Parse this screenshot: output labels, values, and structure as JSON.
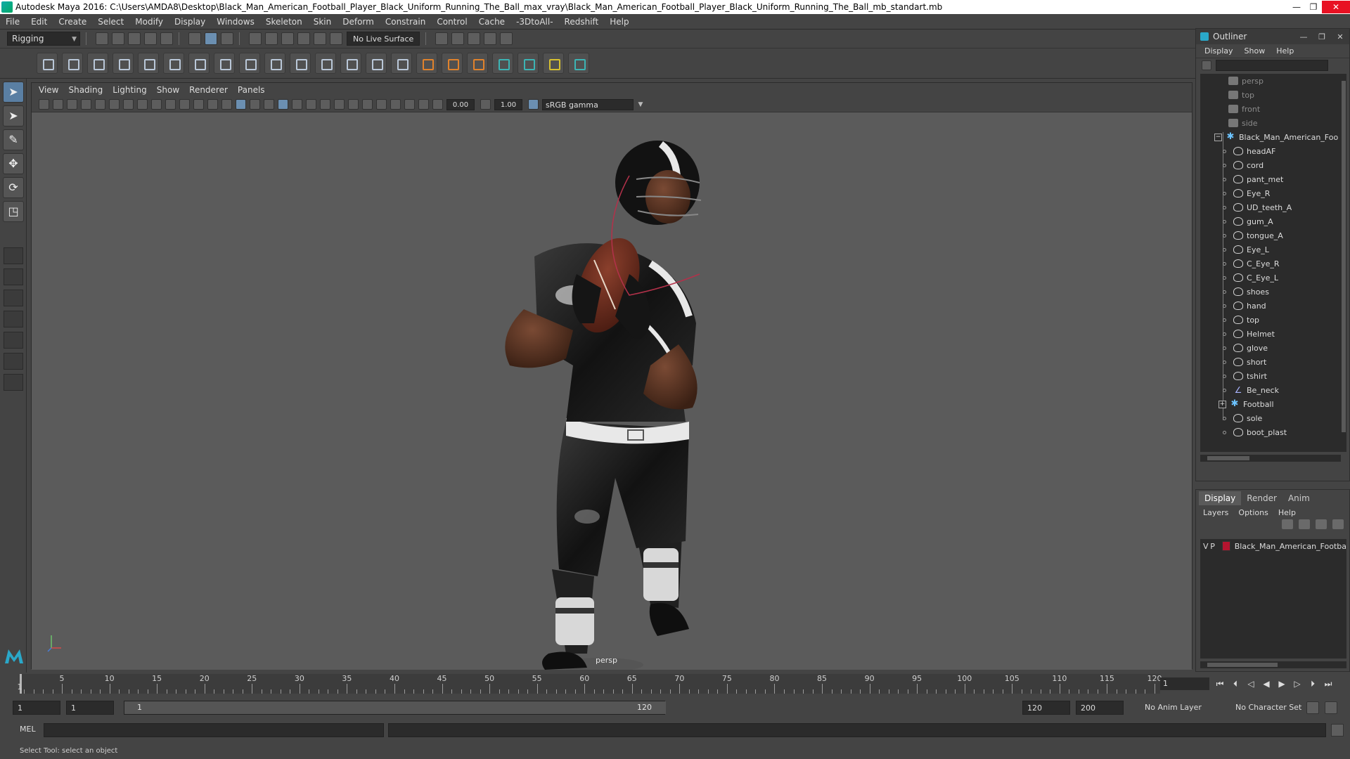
{
  "window": {
    "title": "Autodesk Maya 2016: C:\\Users\\AMDA8\\Desktop\\Black_Man_American_Football_Player_Black_Uniform_Running_The_Ball_max_vray\\Black_Man_American_Football_Player_Black_Uniform_Running_The_Ball_mb_standart.mb",
    "minimize": "—",
    "maximize": "❐",
    "close": "✕"
  },
  "menubar": [
    "File",
    "Edit",
    "Create",
    "Select",
    "Modify",
    "Display",
    "Windows",
    "Skeleton",
    "Skin",
    "Deform",
    "Constrain",
    "Control",
    "Cache",
    "-3DtoAll-",
    "Redshift",
    "Help"
  ],
  "status_line": {
    "mode": "Rigging",
    "live_surface": "No Live Surface"
  },
  "viewport": {
    "menus": [
      "View",
      "Shading",
      "Lighting",
      "Show",
      "Renderer",
      "Panels"
    ],
    "exposure": "0.00",
    "gamma": "1.00",
    "color_space": "sRGB gamma",
    "camera": "persp"
  },
  "outliner": {
    "title": "Outliner",
    "menus": [
      "Display",
      "Show",
      "Help"
    ],
    "cameras": [
      "persp",
      "top",
      "front",
      "side"
    ],
    "root": "Black_Man_American_Foo",
    "children": [
      {
        "name": "headAF",
        "type": "mesh"
      },
      {
        "name": "cord",
        "type": "mesh"
      },
      {
        "name": "pant_met",
        "type": "mesh"
      },
      {
        "name": "Eye_R",
        "type": "mesh"
      },
      {
        "name": "UD_teeth_A",
        "type": "mesh"
      },
      {
        "name": "gum_A",
        "type": "mesh"
      },
      {
        "name": "tongue_A",
        "type": "mesh"
      },
      {
        "name": "Eye_L",
        "type": "mesh"
      },
      {
        "name": "C_Eye_R",
        "type": "mesh"
      },
      {
        "name": "C_Eye_L",
        "type": "mesh"
      },
      {
        "name": "shoes",
        "type": "mesh"
      },
      {
        "name": "hand",
        "type": "mesh"
      },
      {
        "name": "top",
        "type": "mesh"
      },
      {
        "name": "Helmet",
        "type": "mesh"
      },
      {
        "name": "glove",
        "type": "mesh"
      },
      {
        "name": "short",
        "type": "mesh"
      },
      {
        "name": "tshirt",
        "type": "mesh"
      },
      {
        "name": "Be_neck",
        "type": "curve"
      },
      {
        "name": "Football",
        "type": "joint"
      },
      {
        "name": "sole",
        "type": "mesh"
      },
      {
        "name": "boot_plast",
        "type": "mesh"
      }
    ]
  },
  "layer_editor": {
    "tabs": [
      "Display",
      "Render",
      "Anim"
    ],
    "menus": [
      "Layers",
      "Options",
      "Help"
    ],
    "layers": [
      {
        "v": "V",
        "p": "P",
        "name": "Black_Man_American_Footba",
        "color": "#b4142f"
      }
    ]
  },
  "time_slider": {
    "ticks": [
      "5",
      "10",
      "15",
      "20",
      "25",
      "30",
      "35",
      "40",
      "45",
      "50",
      "55",
      "60",
      "65",
      "70",
      "75",
      "80",
      "85",
      "90",
      "95",
      "100",
      "105",
      "110",
      "115",
      "120"
    ],
    "start_label": "1",
    "current_frame": "1"
  },
  "range_slider": {
    "start": "1",
    "playback_start": "1",
    "slider_start": "1",
    "slider_end": "120",
    "playback_end": "120",
    "end": "200",
    "anim_layer": "No Anim Layer",
    "character_set": "No Character Set"
  },
  "command_line": {
    "label": "MEL"
  },
  "help_line": "Select Tool: select an object",
  "colors": {
    "ui_bg": "#444444",
    "viewport_bg": "#5b5b5b",
    "layer_color": "#b4142f"
  }
}
